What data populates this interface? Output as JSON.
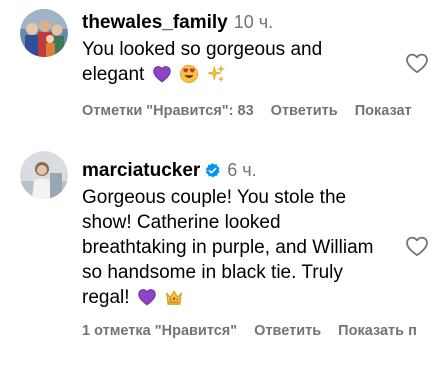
{
  "comments": [
    {
      "username": "thewales_family",
      "time": "10 ч.",
      "verified": false,
      "text_lines": [
        "You looked so gorgeous and",
        "elegant"
      ],
      "emojis": [
        "purple-heart",
        "heart-eyes",
        "sparkles"
      ],
      "actions": {
        "likes": "Отметки \"Нравится\": 83",
        "reply": "Ответить",
        "more": "Показат"
      }
    },
    {
      "username": "marciatucker",
      "time": "6 ч.",
      "verified": true,
      "text_lines": [
        "Gorgeous couple! You stole the",
        "show! Catherine looked",
        "breathtaking in purple, and William",
        "so handsome in black tie. Truly",
        "regal!"
      ],
      "emojis": [
        "purple-heart",
        "crown"
      ],
      "actions": {
        "likes": "1 отметка \"Нравится\"",
        "reply": "Ответить",
        "more": "Показать п"
      }
    }
  ],
  "colors": {
    "text": "#000000",
    "secondary": "#737373",
    "verified_blue": "#0095f6",
    "purple_heart": "#8e44c9"
  }
}
